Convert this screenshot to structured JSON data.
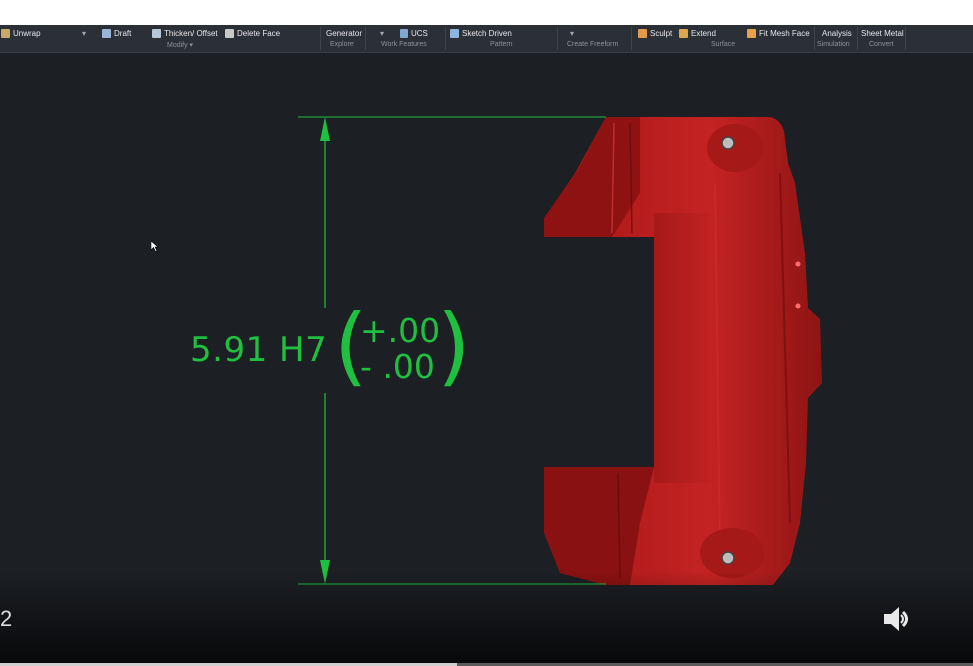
{
  "toolbar": {
    "items": [
      {
        "label": "Unwrap",
        "icon": "unwrap-icon"
      },
      {
        "label": "Draft",
        "icon": "draft-icon"
      },
      {
        "label": "Thicken/ Offset",
        "icon": "thicken-offset-icon"
      },
      {
        "label": "Delete Face",
        "icon": "delete-face-icon"
      },
      {
        "label": "Generator",
        "icon": ""
      },
      {
        "label": "UCS",
        "icon": "ucs-icon"
      },
      {
        "label": "Sketch Driven",
        "icon": "sketch-driven-pattern-icon"
      },
      {
        "label": "Sculpt",
        "icon": "sculpt-icon"
      },
      {
        "label": "Extend",
        "icon": "extend-icon"
      },
      {
        "label": "Fit Mesh Face",
        "icon": "fit-mesh-face-icon"
      },
      {
        "label": "Analysis",
        "icon": ""
      },
      {
        "label": "Sheet Metal",
        "icon": ""
      }
    ],
    "groups": {
      "modify": "Modify ▾",
      "explore": "Explore",
      "work_features": "Work Features",
      "pattern": "Pattern",
      "create_freeform": "Create Freeform",
      "surface": "Surface",
      "simulation": "Simulation",
      "convert": "Convert"
    }
  },
  "dimension": {
    "value": "5.91 H7",
    "upper": "+.00",
    "lower": "- .00",
    "color": "#1fbf3f"
  },
  "video": {
    "left_edge_char": "2",
    "progress_fraction": 0.47,
    "volume_icon": "speaker-icon"
  },
  "colors": {
    "part": "#b01c1c",
    "viewport_bg": "#1c1f24",
    "toolbar_bg": "#2b2f36"
  }
}
